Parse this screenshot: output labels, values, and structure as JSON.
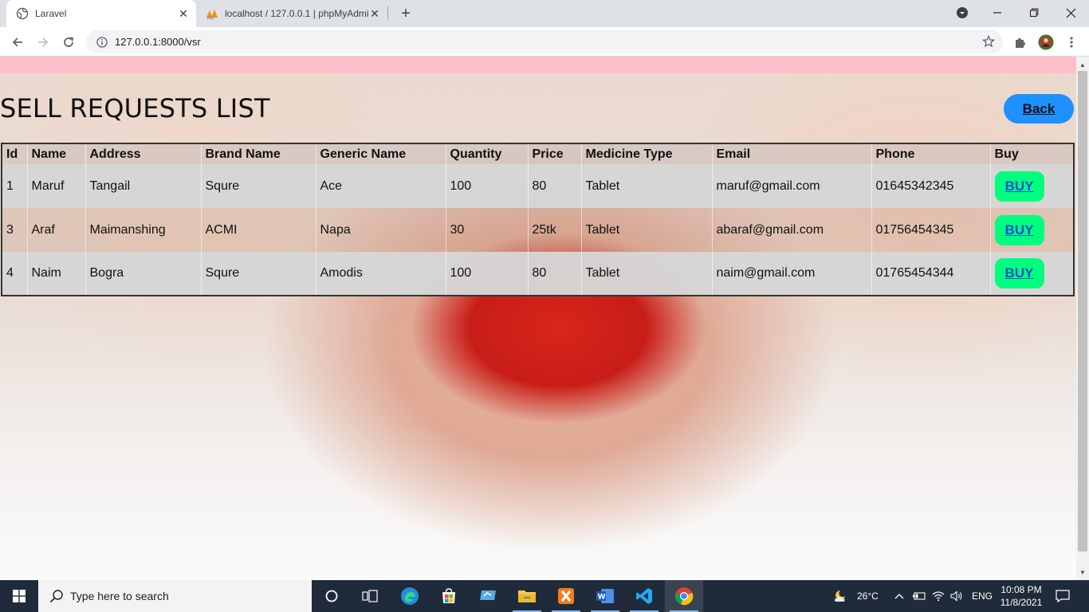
{
  "browser": {
    "tabs": [
      {
        "title": "Laravel",
        "active": true
      },
      {
        "title": "localhost / 127.0.0.1 | phpMyAdmin",
        "active": false
      }
    ],
    "url": "127.0.0.1:8000/vsr"
  },
  "page": {
    "title": "SELL REQUESTS LIST",
    "back_label": "Back",
    "pink_bar_color": "#ffc0cb",
    "back_color": "#1e90ff",
    "buy_color": "#00ff7f"
  },
  "table": {
    "headers": [
      "Id",
      "Name",
      "Address",
      "Brand Name",
      "Generic Name",
      "Quantity",
      "Price",
      "Medicine Type",
      "Email",
      "Phone",
      "Buy"
    ],
    "rows": [
      {
        "id": "1",
        "name": "Maruf",
        "address": "Tangail",
        "brand": "Squre",
        "generic": "Ace",
        "quantity": "100",
        "price": "80",
        "type": "Tablet",
        "email": "maruf@gmail.com",
        "phone": "01645342345",
        "buy": "BUY"
      },
      {
        "id": "3",
        "name": "Araf",
        "address": "Maimanshing",
        "brand": "ACMI",
        "generic": "Napa",
        "quantity": "30",
        "price": "25tk",
        "type": "Tablet",
        "email": "abaraf@gmail.com",
        "phone": "01756454345",
        "buy": "BUY"
      },
      {
        "id": "4",
        "name": "Naim",
        "address": "Bogra",
        "brand": "Squre",
        "generic": "Amodis",
        "quantity": "100",
        "price": "80",
        "type": "Tablet",
        "email": "naim@gmail.com",
        "phone": "01765454344",
        "buy": "BUY"
      }
    ]
  },
  "taskbar": {
    "search_placeholder": "Type here to search",
    "weather": "26°C",
    "language": "ENG",
    "time": "10:08 PM",
    "date": "11/8/2021"
  }
}
